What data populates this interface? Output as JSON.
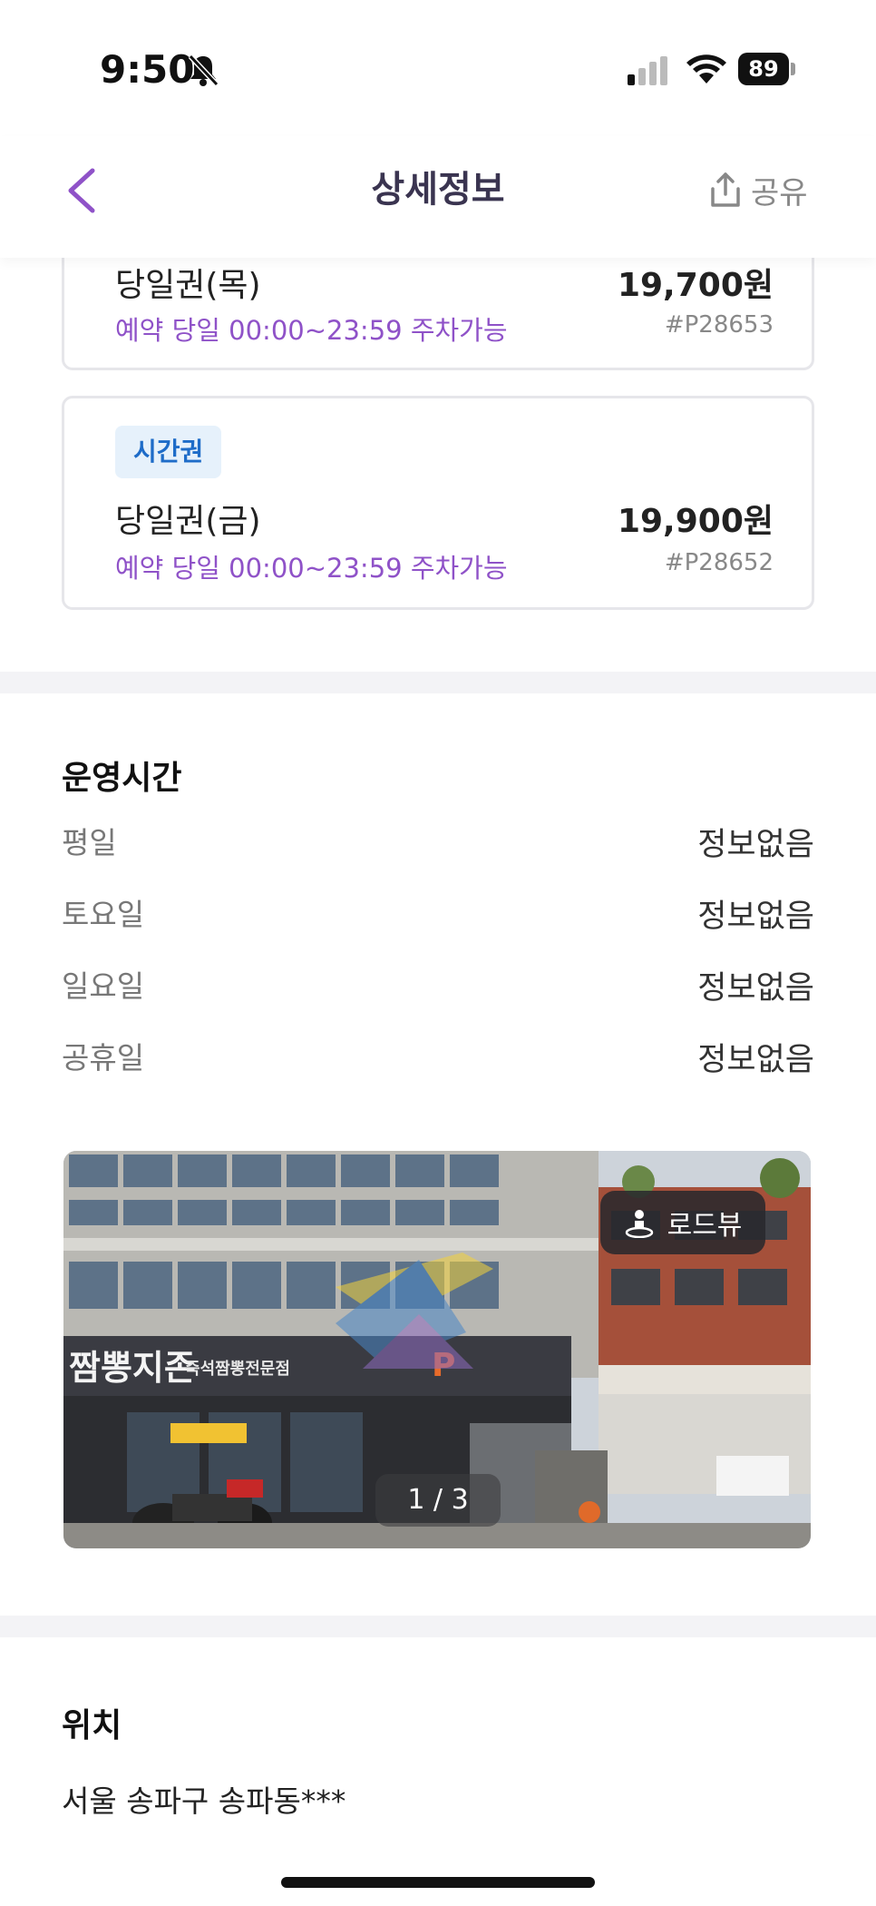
{
  "status_bar": {
    "time": "9:50",
    "battery": "89"
  },
  "header": {
    "title": "상세정보",
    "share_label": "공유"
  },
  "tickets": [
    {
      "name": "당일권(목)",
      "price": "19,700원",
      "desc": "예약 당일 00:00~23:59 주차가능",
      "code": "#P28653"
    },
    {
      "badge": "시간권",
      "name": "당일권(금)",
      "price": "19,900원",
      "desc": "예약 당일 00:00~23:59 주차가능",
      "code": "#P28652"
    }
  ],
  "hours": {
    "title": "운영시간",
    "rows": [
      {
        "label": "평일",
        "value": "정보없음"
      },
      {
        "label": "토요일",
        "value": "정보없음"
      },
      {
        "label": "일요일",
        "value": "정보없음"
      },
      {
        "label": "공휴일",
        "value": "정보없음"
      }
    ]
  },
  "photo": {
    "road_view_label": "로드뷰",
    "counter": "1 / 3",
    "sign_text": "즉석짬뽕전문점",
    "store_sign": "짬뽕지존"
  },
  "location": {
    "title": "위치",
    "address": "서울 송파구 송파동***"
  },
  "colors": {
    "accent": "#8f52c8",
    "badge_bg": "#e6f1fb",
    "badge_text": "#1e6cc8",
    "title": "#3a3450"
  },
  "icons": {
    "back": "chevron-left-icon",
    "share": "share-icon",
    "road_view": "person-pin-icon",
    "silent": "bell-slash-icon"
  }
}
